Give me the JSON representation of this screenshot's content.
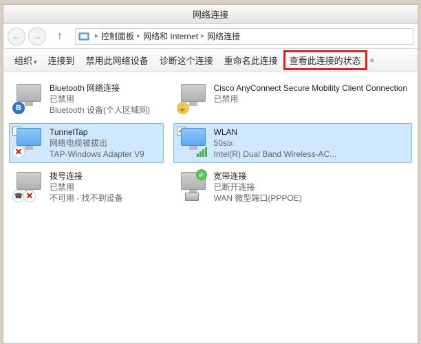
{
  "title": "网络连接",
  "breadcrumb": {
    "parts": [
      "控制面板",
      "网络和 Internet",
      "网络连接"
    ]
  },
  "toolbar": {
    "org": "组织",
    "connect": "连接到",
    "disable": "禁用此网络设备",
    "diagnose": "诊断这个连接",
    "rename": "重命名此连接",
    "status": "查看此连接的状态"
  },
  "items": [
    {
      "name": "Bluetooth 网络连接",
      "status": "已禁用",
      "device": "Bluetooth 设备(个人区域网)",
      "selected": false,
      "checked": null,
      "iconBadge": "bt",
      "gray": true
    },
    {
      "name": "Cisco AnyConnect Secure Mobility Client Connection",
      "status": "已禁用",
      "device": "",
      "selected": false,
      "checked": null,
      "iconBadge": "lock",
      "gray": true
    },
    {
      "name": "TunnelTap",
      "status": "网络电缆被拔出",
      "device": "TAP-Windows Adapter V9",
      "selected": true,
      "checked": false,
      "iconBadge": "x",
      "gray": false
    },
    {
      "name": "WLAN",
      "status": "50six",
      "device": "Intel(R) Dual Band Wireless-AC...",
      "selected": true,
      "checked": true,
      "iconBadge": "sig",
      "gray": false
    },
    {
      "name": "拨号连接",
      "status": "已禁用",
      "device": "不可用 - 找不到设备",
      "selected": false,
      "checked": null,
      "iconBadge": "telx",
      "gray": true
    },
    {
      "name": "宽带连接",
      "status": "已断开连接",
      "device": "WAN 微型端口(PPPOE)",
      "selected": false,
      "checked": null,
      "iconBadge": "hddok",
      "gray": true
    }
  ]
}
